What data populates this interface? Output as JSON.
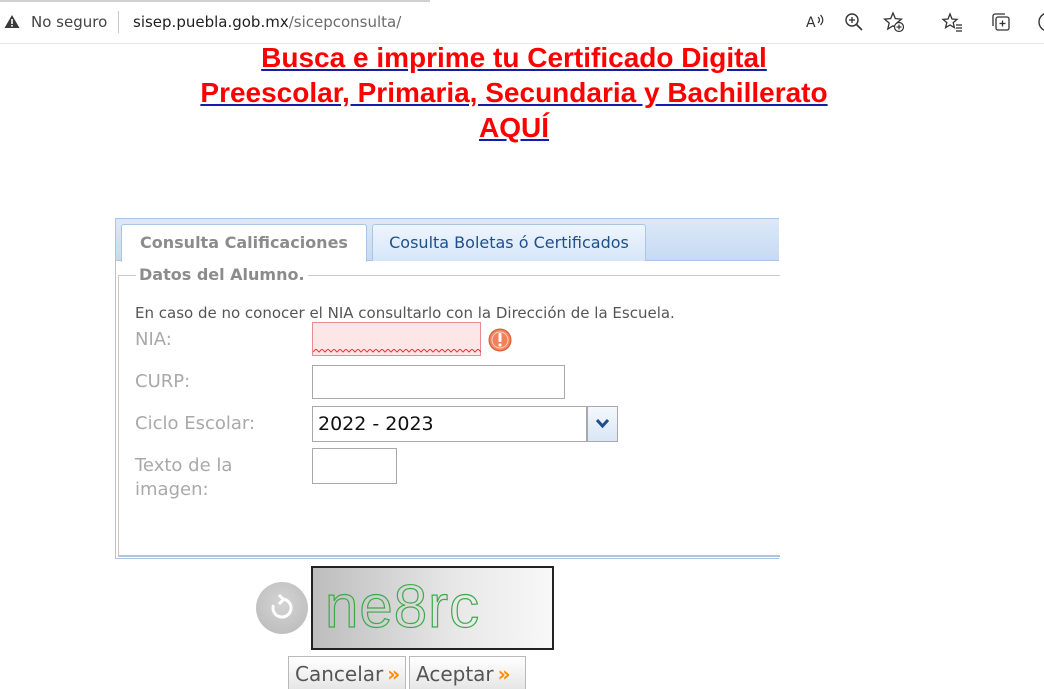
{
  "browser": {
    "security_label": "No seguro",
    "url_domain": "sisep.puebla.gob.mx",
    "url_path": "/sicepconsulta/",
    "toolbar_icons": [
      "read-aloud-icon",
      "zoom-icon",
      "add-favorite-icon",
      "favorites-icon",
      "collections-icon"
    ]
  },
  "headline": {
    "line1": "Busca e imprime tu Certificado Digital",
    "line2": "Preescolar, Primaria, Secundaria y Bachillerato",
    "line3": "AQUÍ",
    "color": "#ff0000"
  },
  "tabs": [
    {
      "label": "Consulta Calificaciones",
      "active": true
    },
    {
      "label": "Cosulta Boletas ó Certificados",
      "active": false
    }
  ],
  "form": {
    "legend": "Datos del Alumno.",
    "hint": "En caso de no conocer el NIA consultarlo con la Dirección de la Escuela.",
    "nia_label": "NIA:",
    "nia_value": "",
    "curp_label": "CURP:",
    "curp_value": "",
    "ciclo_label": "Ciclo Escolar:",
    "ciclo_value": "2022 - 2023",
    "texto_label_line1": "Texto de la",
    "texto_label_line2": "imagen:",
    "texto_value": ""
  },
  "captcha": {
    "text": "ne8rc"
  },
  "buttons": {
    "cancel": "Cancelar",
    "accept": "Aceptar",
    "chevron": "»"
  }
}
